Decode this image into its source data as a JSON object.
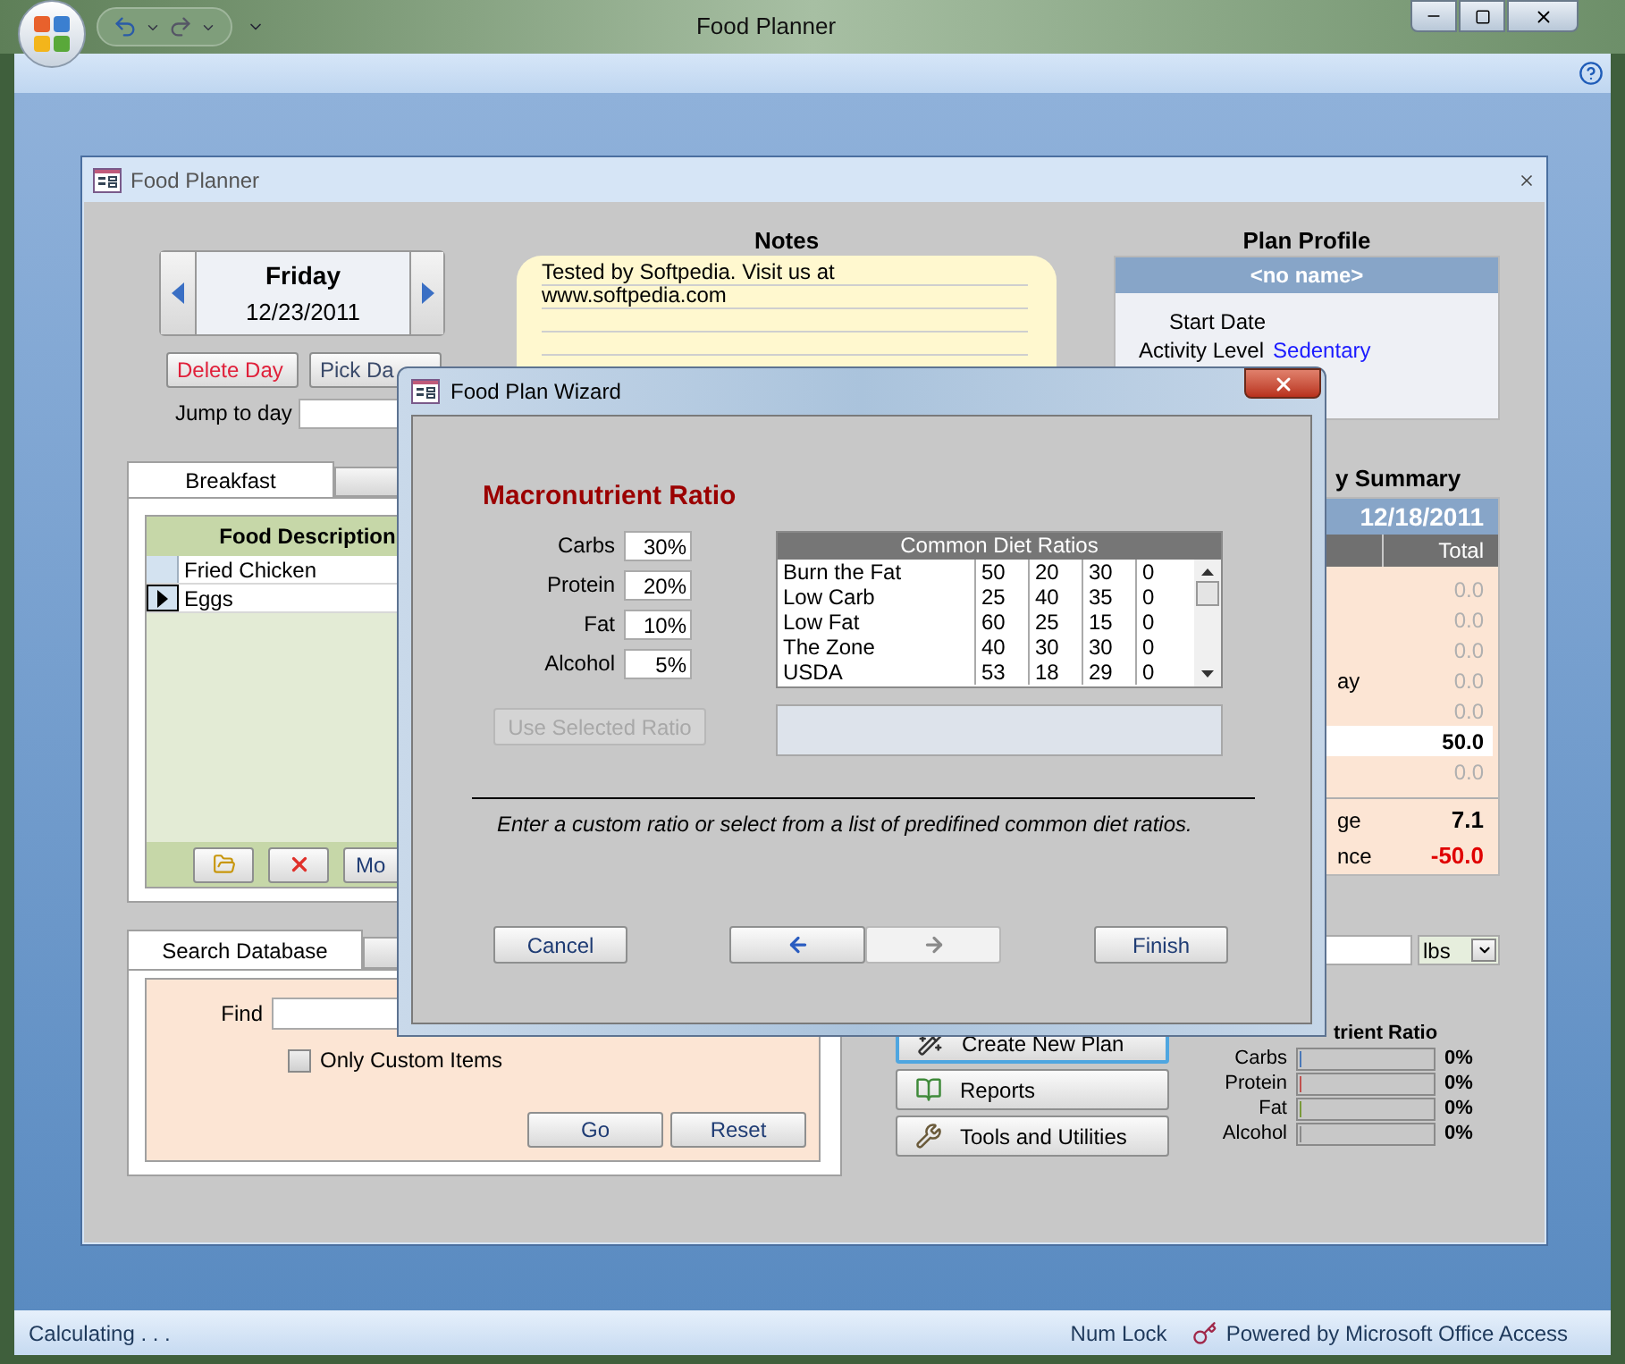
{
  "app": {
    "title": "Food Planner"
  },
  "form": {
    "title": "Food Planner",
    "day": {
      "weekday": "Friday",
      "date": "12/23/2011"
    },
    "day_buttons": [
      {
        "label": "Delete Day",
        "kind": "danger"
      },
      {
        "label": "Pick Da",
        "kind": "normal"
      }
    ],
    "jump_label": "Jump to day",
    "notes": {
      "heading": "Notes",
      "text": "Tested by Softpedia. Visit us at www.softpedia.com"
    },
    "profile": {
      "heading": "Plan Profile",
      "name": "<no name>",
      "start_date_label": "Start Date",
      "activity_label": "Activity Level",
      "activity_value": "Sedentary"
    },
    "meal_tabs": [
      {
        "label": "Breakfast",
        "selected": true
      },
      {
        "selected": false
      }
    ],
    "food_table": {
      "column": "Food Description",
      "rows": [
        {
          "name": "Fried Chicken",
          "selected": false
        },
        {
          "name": "Eggs",
          "selected": true
        }
      ],
      "more_button": "Mo"
    },
    "search_tabs": [
      {
        "label": "Search Database",
        "selected": true
      },
      {
        "selected": false
      }
    ],
    "search": {
      "find_label": "Find",
      "custom_only": {
        "label": "Only Custom Items",
        "checked": false
      },
      "buttons": [
        "Go",
        "Reset"
      ]
    },
    "actions": [
      {
        "label": "Create New Plan",
        "kind": "wand",
        "focused": true
      },
      {
        "label": "Reports",
        "kind": "reports",
        "focused": false
      },
      {
        "label": "Tools and Utilities",
        "kind": "tools",
        "focused": false
      }
    ],
    "summary": {
      "heading": "y Summary",
      "date": "12/18/2011",
      "column": "Total",
      "rows": [
        {
          "value": "0.0",
          "kind": "muted"
        },
        {
          "value": "0.0",
          "kind": "muted"
        },
        {
          "value": "0.0",
          "kind": "muted"
        },
        {
          "label": "ay",
          "value": "0.0",
          "kind": "muted"
        },
        {
          "value": "0.0",
          "kind": "muted"
        },
        {
          "value": "50.0",
          "kind": "highlight"
        },
        {
          "value": "0.0",
          "kind": "muted"
        }
      ],
      "footer_rows": [
        {
          "label": "ge",
          "value": "7.1",
          "kind": "bold"
        },
        {
          "label": "nce",
          "value": "-50.0",
          "kind": "negative"
        }
      ]
    },
    "weight": {
      "unit": "lbs"
    },
    "ratio": {
      "heading": "trient Ratio",
      "bars": [
        {
          "label": "Carbs",
          "level": 0,
          "color": "#4a78b8",
          "reading": "0%"
        },
        {
          "label": "Protein",
          "level": 0,
          "color": "#c0504d",
          "reading": "0%"
        },
        {
          "label": "Fat",
          "level": 0,
          "color": "#7a9a3a",
          "reading": "0%"
        },
        {
          "label": "Alcohol",
          "level": 0,
          "color": "#8a8a8a",
          "reading": "0%"
        }
      ]
    }
  },
  "wizard": {
    "title": "Food Plan Wizard",
    "heading": "Macronutrient Ratio",
    "fields": [
      {
        "label": "Carbs",
        "value": "30%"
      },
      {
        "label": "Protein",
        "value": "20%"
      },
      {
        "label": "Fat",
        "value": "10%"
      },
      {
        "label": "Alcohol",
        "value": "5%"
      }
    ],
    "use_button": {
      "label": "Use Selected Ratio",
      "disabled": true
    },
    "ratios": {
      "heading": "Common Diet Ratios",
      "rows": [
        {
          "name": "Burn the Fat",
          "values": [
            "50",
            "20",
            "30",
            "0"
          ]
        },
        {
          "name": "Low Carb",
          "values": [
            "25",
            "40",
            "35",
            "0"
          ]
        },
        {
          "name": "Low Fat",
          "values": [
            "60",
            "25",
            "15",
            "0"
          ]
        },
        {
          "name": "The Zone",
          "values": [
            "40",
            "30",
            "30",
            "0"
          ]
        },
        {
          "name": "USDA",
          "values": [
            "53",
            "18",
            "29",
            "0"
          ]
        }
      ]
    },
    "hint": "Enter a custom ratio or select from a list of predifined common diet ratios.",
    "cancel": "Cancel",
    "finish": "Finish",
    "nav": [
      {
        "kind": "back",
        "disabled": false
      },
      {
        "kind": "next",
        "disabled": true
      }
    ]
  },
  "status_bar": {
    "message": "Calculating . . .",
    "num_lock": "Num Lock",
    "powered_by": "Powered by Microsoft Office Access"
  }
}
